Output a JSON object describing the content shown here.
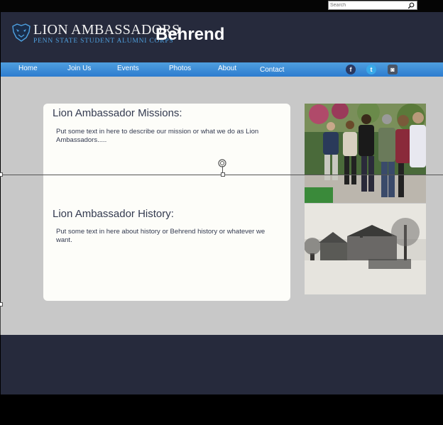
{
  "search": {
    "placeholder": "Search"
  },
  "header": {
    "brand_name": "LION AMBASSADORS",
    "brand_sub": "PENN STATE STUDENT ALUMNI CORPS",
    "campus": "Behrend"
  },
  "nav": {
    "items": [
      "Home",
      "Join Us",
      "Events",
      "Photos",
      "About",
      "Contact"
    ],
    "social": {
      "facebook": "f",
      "twitter": "t",
      "instagram": "◙"
    }
  },
  "main": {
    "mission_title": "Lion Ambassador Missions:",
    "mission_text": "Put some text in here to describe our mission or what we do as Lion Ambassadors.....",
    "history_title": "Lion Ambassador History:",
    "history_text": "Put some text in here about history or Behrend history or whatever we want."
  },
  "colors": {
    "header_bg": "#262a3c",
    "nav_blue": "#3a8ad6",
    "content_bg": "#c8c8c8",
    "card_bg": "#fdfdf9",
    "brand_blue": "#4fa0df"
  }
}
